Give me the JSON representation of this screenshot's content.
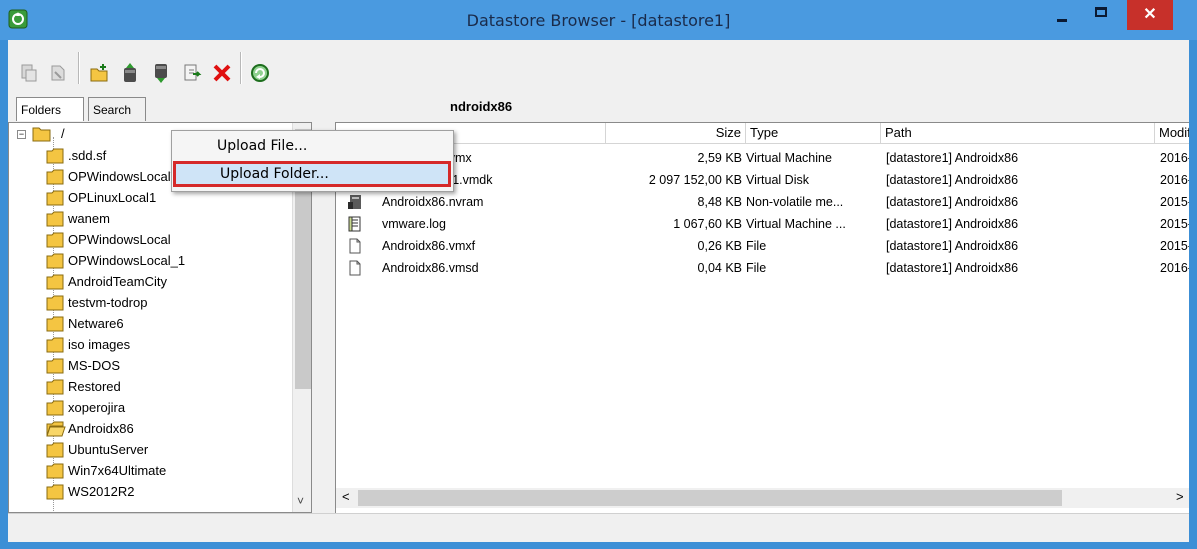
{
  "window": {
    "title": "Datastore Browser - [datastore1]",
    "close_glyph": "✕"
  },
  "toolbar": {
    "icons": [
      "expand-icon",
      "collapse-icon",
      "new-folder-icon",
      "upload-icon",
      "download-icon",
      "move-icon",
      "delete-icon",
      "refresh-icon"
    ]
  },
  "tabs": [
    {
      "label": "Folders"
    },
    {
      "label": "Search"
    }
  ],
  "tree": {
    "root_label": "/",
    "items": [
      ".sdd.sf",
      "OPWindowsLocalTest",
      "OPLinuxLocal1",
      "wanem",
      "OPWindowsLocal",
      "OPWindowsLocal_1",
      "AndroidTeamCity",
      "testvm-todrop",
      "Netware6",
      "iso images",
      "MS-DOS",
      "Restored",
      "xoperojira",
      "Androidx86",
      "UbuntuServer",
      "Win7x64Ultimate",
      "WS2012R2"
    ],
    "selected": "Androidx86"
  },
  "path_bar": {
    "label": "ndroidx86"
  },
  "columns": {
    "size": "Size",
    "type": "Type",
    "path": "Path",
    "modified": "Modif"
  },
  "files": [
    {
      "icon": "virtual-machine-icon",
      "name": "Androidx86.vmx",
      "size": "2,59 KB",
      "type": "Virtual Machine",
      "path": "[datastore1] Androidx86",
      "modified": "2016-("
    },
    {
      "icon": "virtual-disk-icon",
      "name": "Androidx86_1.vmdk",
      "size": "2 097 152,00 KB",
      "type": "Virtual Disk",
      "path": "[datastore1] Androidx86",
      "modified": "2016-("
    },
    {
      "icon": "nvram-icon",
      "name": "Androidx86.nvram",
      "size": "8,48 KB",
      "type": "Non-volatile me...",
      "path": "[datastore1] Androidx86",
      "modified": "2015-1"
    },
    {
      "icon": "log-file-icon",
      "name": "vmware.log",
      "size": "1 067,60 KB",
      "type": "Virtual Machine ...",
      "path": "[datastore1] Androidx86",
      "modified": "2015-1"
    },
    {
      "icon": "file-icon",
      "name": "Androidx86.vmxf",
      "size": "0,26 KB",
      "type": "File",
      "path": "[datastore1] Androidx86",
      "modified": "2015-1"
    },
    {
      "icon": "file-icon",
      "name": "Androidx86.vmsd",
      "size": "0,04 KB",
      "type": "File",
      "path": "[datastore1] Androidx86",
      "modified": "2016-("
    }
  ],
  "popup_menu": {
    "items": [
      {
        "label": "Upload File..."
      },
      {
        "label": "Upload Folder..."
      }
    ],
    "highlighted": "Upload Folder..."
  },
  "scrollbar": {
    "left_arrow": "<",
    "right_arrow": ">",
    "down_arrow": "˅"
  },
  "colors": {
    "titlebar": "#4a9ae0",
    "close_button": "#c7302a",
    "highlight_border": "#d52929",
    "menu_highlight": "#cfe4f7",
    "folder": "#f4c542"
  }
}
